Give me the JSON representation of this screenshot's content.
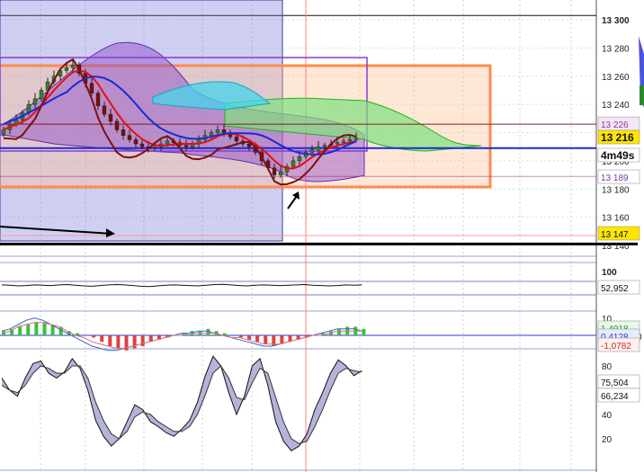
{
  "chart_data": [
    {
      "type": "candlestick",
      "panel": "price",
      "y_ticks": [
        "13 300",
        "13 280",
        "13 260",
        "13 240",
        "13 220",
        "13 200",
        "13 180",
        "13 160",
        "13 140"
      ],
      "y_tick_values": [
        13300,
        13280,
        13260,
        13240,
        13220,
        13200,
        13180,
        13160,
        13140
      ],
      "ylim": [
        13135,
        13310
      ],
      "labels": {
        "upper": "13 226",
        "current": "13 216",
        "timer": "4m49s",
        "lower": "13 189",
        "low_level": "13 147"
      },
      "current_price": 13216,
      "upper_band_value": 13226,
      "lower_band_value": 13189,
      "blue_line_value": 13209,
      "support_value": 13147,
      "black_line_value": 13141,
      "top_line_value": 13303,
      "close": [
        13222,
        13226,
        13229,
        13234,
        13240,
        13244,
        13250,
        13256,
        13260,
        13264,
        13266,
        13268,
        13262,
        13255,
        13248,
        13239,
        13233,
        13228,
        13222,
        13218,
        13215,
        13212,
        13210,
        13209,
        13210,
        13212,
        13214,
        13213,
        13211,
        13210,
        13212,
        13215,
        13218,
        13220,
        13222,
        13220,
        13217,
        13214,
        13212,
        13210,
        13206,
        13200,
        13195,
        13190,
        13192,
        13196,
        13200,
        13203,
        13206,
        13208,
        13210,
        13211,
        13212,
        13213,
        13214,
        13215,
        13216
      ],
      "colors": {
        "up": "#2a8a2a",
        "down": "#7a1010",
        "accent": "#ffe600",
        "channel": "#1a1a1a",
        "projection": "#ff8a50"
      }
    },
    {
      "type": "line",
      "panel": "rsi",
      "y_ticks": [
        "100"
      ],
      "label": "52,952",
      "values": [
        53,
        52,
        50,
        51,
        53,
        52,
        51,
        53,
        54,
        52,
        50,
        49,
        51,
        53,
        54,
        53,
        51,
        49,
        48,
        50,
        52,
        53,
        52,
        51,
        50,
        52,
        54,
        55,
        53,
        51,
        50,
        52,
        53,
        52,
        51,
        52,
        53,
        54,
        52,
        51,
        50,
        51,
        53,
        52,
        53
      ],
      "ylim": [
        0,
        100
      ]
    },
    {
      "type": "macd",
      "panel": "macd",
      "y_ticks": [
        "10",
        "0"
      ],
      "labels": [
        "1,4918",
        "0,4128",
        "-1,0782"
      ],
      "histogram": [
        2,
        3,
        4,
        5,
        6,
        6,
        5,
        4,
        2,
        1,
        0,
        -1,
        -3,
        -5,
        -6,
        -7,
        -6,
        -5,
        -3,
        -2,
        -1,
        0,
        1,
        2,
        2,
        3,
        2,
        1,
        0,
        -1,
        -2,
        -3,
        -4,
        -5,
        -4,
        -3,
        -2,
        -1,
        0,
        1,
        2,
        3,
        4,
        4,
        3
      ],
      "macd": [
        2,
        3,
        5,
        7,
        8,
        7,
        5,
        3,
        1,
        -1,
        -3,
        -5,
        -6,
        -7,
        -7,
        -6,
        -5,
        -4,
        -3,
        -2,
        -1,
        0,
        1,
        1,
        2,
        2,
        1,
        0,
        -1,
        -2,
        -3,
        -4,
        -5,
        -5,
        -4,
        -3,
        -2,
        -1,
        0,
        1,
        2,
        3,
        3,
        3,
        2
      ],
      "signal": [
        1,
        2,
        4,
        5,
        6,
        6,
        5,
        4,
        2,
        0,
        -1,
        -3,
        -4,
        -5,
        -6,
        -6,
        -5,
        -4,
        -3,
        -2,
        -1,
        0,
        0,
        1,
        1,
        1,
        1,
        0,
        -1,
        -1,
        -2,
        -3,
        -4,
        -4,
        -4,
        -3,
        -2,
        -1,
        0,
        0,
        1,
        2,
        2,
        2,
        2
      ],
      "ylim": [
        -10,
        10
      ]
    },
    {
      "type": "line",
      "panel": "stochastic",
      "y_ticks": [
        "80",
        "60",
        "40",
        "20"
      ],
      "y_tick_values": [
        80,
        60,
        40,
        20
      ],
      "labels": [
        "75,504",
        "66,234"
      ],
      "k": [
        70,
        60,
        55,
        70,
        82,
        84,
        74,
        70,
        75,
        86,
        78,
        60,
        35,
        22,
        14,
        20,
        34,
        48,
        44,
        34,
        30,
        25,
        22,
        28,
        35,
        50,
        72,
        88,
        80,
        58,
        40,
        55,
        80,
        86,
        64,
        34,
        18,
        10,
        14,
        24,
        44,
        58,
        74,
        85,
        80,
        72,
        76
      ],
      "d": [
        64,
        60,
        58,
        64,
        74,
        80,
        78,
        74,
        74,
        80,
        80,
        70,
        50,
        35,
        24,
        20,
        26,
        38,
        42,
        40,
        34,
        30,
        26,
        26,
        30,
        40,
        56,
        74,
        80,
        70,
        54,
        52,
        66,
        78,
        74,
        54,
        34,
        20,
        16,
        18,
        30,
        44,
        60,
        74,
        78,
        76,
        75
      ],
      "ylim": [
        0,
        100
      ]
    }
  ]
}
